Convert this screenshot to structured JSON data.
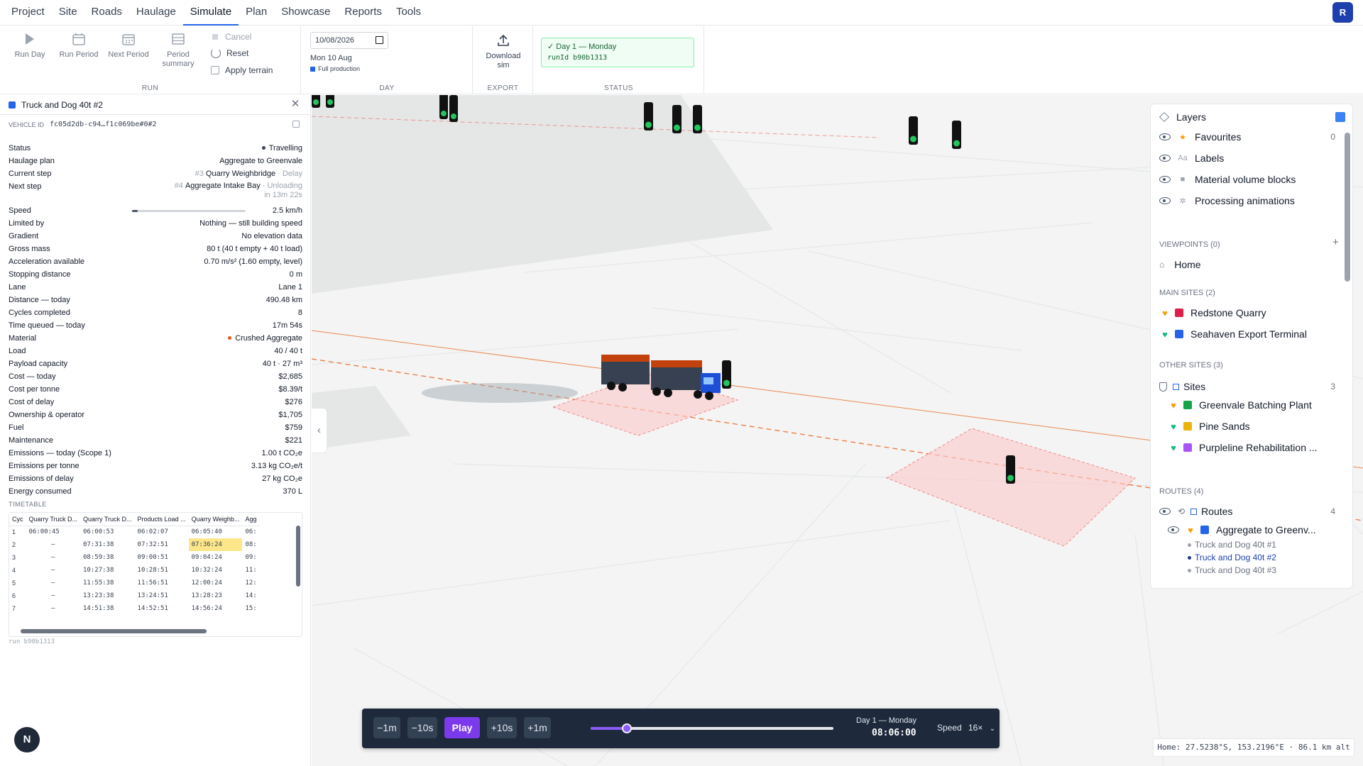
{
  "menu": [
    "Project",
    "Site",
    "Roads",
    "Haulage",
    "Simulate",
    "Plan",
    "Showcase",
    "Reports",
    "Tools"
  ],
  "user": {
    "initial": "R"
  },
  "ribbon": {
    "run": {
      "label": "RUN",
      "run_day": "Run Day",
      "run_period": "Run Period",
      "next_period": "Next Period",
      "period_summary": "Period summary",
      "cancel": "Cancel",
      "reset": "Reset",
      "apply_terrain": "Apply terrain"
    },
    "day": {
      "label": "DAY",
      "date_value": "10/08/2026",
      "date_text": "Mon 10 Aug",
      "production": "Full production"
    },
    "export": {
      "label": "EXPORT",
      "download": "Download sim"
    },
    "status": {
      "label": "STATUS",
      "line1": "✓ Day 1 — Monday",
      "line2": "runId b90b1313"
    }
  },
  "vehicle": {
    "title": "Truck and Dog 40t #2",
    "color": "#2563eb",
    "id_label": "VEHICLE ID",
    "id_value": "fc05d2db-c94…f1c069be#0#2",
    "props": [
      {
        "k": "Status",
        "v": "Travelling",
        "dot": "#374151"
      },
      {
        "k": "Haulage plan",
        "v": "Aggregate to Greenvale"
      },
      {
        "k": "Current step",
        "pre": "#3",
        "v": "Quarry Weighbridge",
        "post": "· Delay"
      },
      {
        "k": "Next step",
        "pre": "#4",
        "v": "Aggregate Intake Bay",
        "post": "· Unloading",
        "post2": "in 13m 22s",
        "tall": true
      },
      {
        "k": "Speed",
        "v": "2.5 km/h",
        "bar": true
      },
      {
        "k": "Limited by",
        "v": "Nothing — still building speed"
      },
      {
        "k": "Gradient",
        "v": "No elevation data"
      },
      {
        "k": "Gross mass",
        "v": "80 t (40 t empty + 40 t load)"
      },
      {
        "k": "Acceleration available",
        "v": "0.70 m/s² (1.60 empty, level)"
      },
      {
        "k": "Stopping distance",
        "v": "0 m"
      },
      {
        "k": "Lane",
        "v": "Lane 1"
      },
      {
        "k": "Distance — today",
        "v": "490.48 km"
      },
      {
        "k": "Cycles completed",
        "v": "8"
      },
      {
        "k": "Time queued — today",
        "v": "17m 54s"
      },
      {
        "k": "Material",
        "v": "Crushed Aggregate",
        "dot": "#ea580c"
      },
      {
        "k": "Load",
        "v": "40 / 40 t"
      },
      {
        "k": "Payload capacity",
        "v": "40 t · 27 m³"
      },
      {
        "k": "Cost — today",
        "v": "$2,685"
      },
      {
        "k": "Cost per tonne",
        "v": "$8.39/t"
      },
      {
        "k": "Cost of delay",
        "v": "$276"
      },
      {
        "k": "Ownership & operator",
        "v": "$1,705"
      },
      {
        "k": "Fuel",
        "v": "$759"
      },
      {
        "k": "Maintenance",
        "v": "$221"
      },
      {
        "k": "Emissions — today (Scope 1)",
        "v": "1.00 t CO₂e"
      },
      {
        "k": "Emissions per tonne",
        "v": "3.13 kg CO₂e/t"
      },
      {
        "k": "Emissions of delay",
        "v": "27 kg CO₂e"
      },
      {
        "k": "Energy consumed",
        "v": "370 L"
      }
    ],
    "speed_fraction": 0.05
  },
  "timetable": {
    "label": "TIMETABLE",
    "headers": [
      "Cyc",
      "Quarry Truck D...",
      "Quarry Truck D...",
      "Products Load ...",
      "Quarry Weighb...",
      "Agg"
    ],
    "rows": [
      [
        "1",
        "06:00:45",
        "06:00:53",
        "06:02:07",
        "06:05:40",
        "06:"
      ],
      [
        "2",
        "—",
        "07:31:38",
        "07:32:51",
        "07:36:24",
        "08:"
      ],
      [
        "3",
        "—",
        "08:59:38",
        "09:00:51",
        "09:04:24",
        "09:"
      ],
      [
        "4",
        "—",
        "10:27:38",
        "10:28:51",
        "10:32:24",
        "11:"
      ],
      [
        "5",
        "—",
        "11:55:38",
        "11:56:51",
        "12:00:24",
        "12:"
      ],
      [
        "6",
        "—",
        "13:23:38",
        "13:24:51",
        "13:28:23",
        "14:"
      ],
      [
        "7",
        "—",
        "14:51:38",
        "14:52:51",
        "14:56:24",
        "15:"
      ]
    ],
    "highlight": {
      "row": 1,
      "col": 4
    }
  },
  "run_footer": "run b90b1313",
  "nav_badge": "N",
  "layers": {
    "title": "Layers",
    "items": [
      {
        "label": "Favourites",
        "icon": "star-icon",
        "count": "0"
      },
      {
        "label": "Labels",
        "icon": "text-icon"
      },
      {
        "label": "Material volume blocks",
        "icon": "cube-icon"
      },
      {
        "label": "Processing animations",
        "icon": "gear-icon"
      }
    ],
    "viewpoints_label": "VIEWPOINTS (0)",
    "home": "Home",
    "main_sites_label": "MAIN SITES (2)",
    "main_sites": [
      {
        "label": "Redstone Quarry",
        "heart": "#f59e0b",
        "color": "#e11d48"
      },
      {
        "label": "Seahaven Export Terminal",
        "heart": "#10b981",
        "color": "#2563eb"
      }
    ],
    "other_sites_label": "OTHER SITES (3)",
    "sites_group": {
      "label": "Sites",
      "count": "3"
    },
    "other_sites": [
      {
        "label": "Greenvale Batching Plant",
        "heart": "#f59e0b",
        "color": "#16a34a"
      },
      {
        "label": "Pine Sands",
        "heart": "#10b981",
        "color": "#eab308"
      },
      {
        "label": "Purpleline Rehabilitation ...",
        "heart": "#10b981",
        "color": "#a855f7"
      }
    ],
    "routes_label": "ROUTES (4)",
    "routes_group": {
      "label": "Routes",
      "count": "4"
    },
    "route": {
      "label": "Aggregate to Greenv...",
      "heart": "#f59e0b",
      "color": "#2563eb"
    },
    "vehicles": [
      "Truck and Dog 40t #1",
      "Truck and Dog 40t #2",
      "Truck and Dog 40t #3"
    ]
  },
  "transport": {
    "back_1m": "−1m",
    "back_10s": "−10s",
    "play": "Play",
    "fwd_10s": "+10s",
    "fwd_1m": "+1m",
    "progress": 0.15,
    "day": "Day 1 — Monday",
    "time": "08:06:00",
    "speed_label": "Speed",
    "speed_value": "16×"
  },
  "coords": "Home: 27.5238°S, 153.2196°E · 86.1 km alt"
}
